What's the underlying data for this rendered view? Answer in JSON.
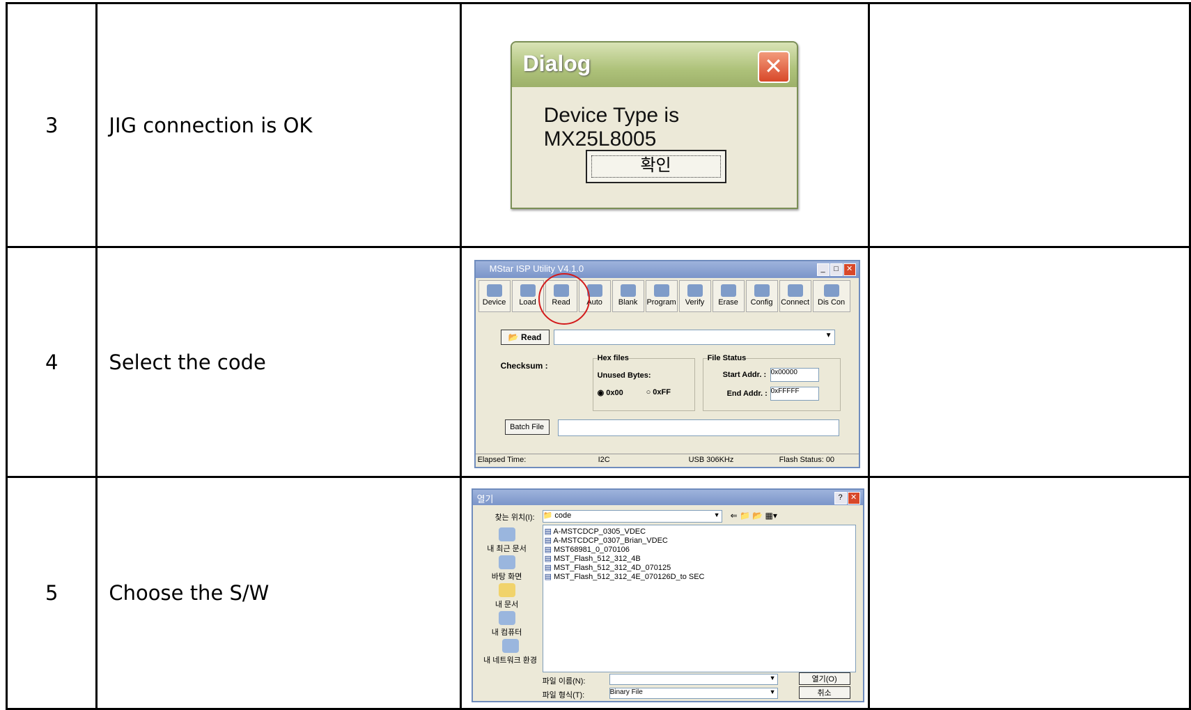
{
  "rows": [
    {
      "num": "3",
      "desc": "JIG connection is OK"
    },
    {
      "num": "4",
      "desc": "Select the code"
    },
    {
      "num": "5",
      "desc": "Choose the S/W"
    }
  ],
  "dialog": {
    "title": "Dialog",
    "message": "Device Type is MX25L8005",
    "ok": "확인",
    "close_icon": "close-icon"
  },
  "isp": {
    "title": "MStar ISP Utility V4.1.0",
    "tools": [
      "Device",
      "Load",
      "Read",
      "Auto",
      "Blank",
      "Program",
      "Verify",
      "Erase",
      "Config",
      "Connect",
      "Dis Con"
    ],
    "read_button": "Read",
    "checksum": "Checksum :",
    "hex_group": "Hex files",
    "unused": "Unused Bytes:",
    "opt1": "0x00",
    "opt2": "0xFF",
    "status_group": "File Status",
    "start_label": "Start Addr. :",
    "start_val": "0x00000",
    "end_label": "End Addr. :",
    "end_val": "0xFFFFF",
    "batch": "Batch File",
    "status": {
      "elapsed": "Elapsed Time:",
      "bus": "I2C",
      "usb": "USB  306KHz",
      "flash": "Flash Status: 00"
    },
    "highlight_color": "#d31b1b"
  },
  "fileopen": {
    "title": "열기",
    "lookin_label": "찾는 위치(I):",
    "lookin_val": "code",
    "side": [
      "내 최근 문서",
      "바탕 화면",
      "내 문서",
      "내 컴퓨터",
      "내 네트워크 환경"
    ],
    "files": [
      "A-MSTCDCP_0305_VDEC",
      "A-MSTCDCP_0307_Brian_VDEC",
      "MST68981_0_070106",
      "MST_Flash_512_312_4B",
      "MST_Flash_512_312_4D_070125",
      "MST_Flash_512_312_4E_070126D_to SEC"
    ],
    "filename_label": "파일 이름(N):",
    "filetype_label": "파일 형식(T):",
    "filetype_val": "Binary File",
    "open": "열기(O)",
    "cancel": "취소"
  }
}
